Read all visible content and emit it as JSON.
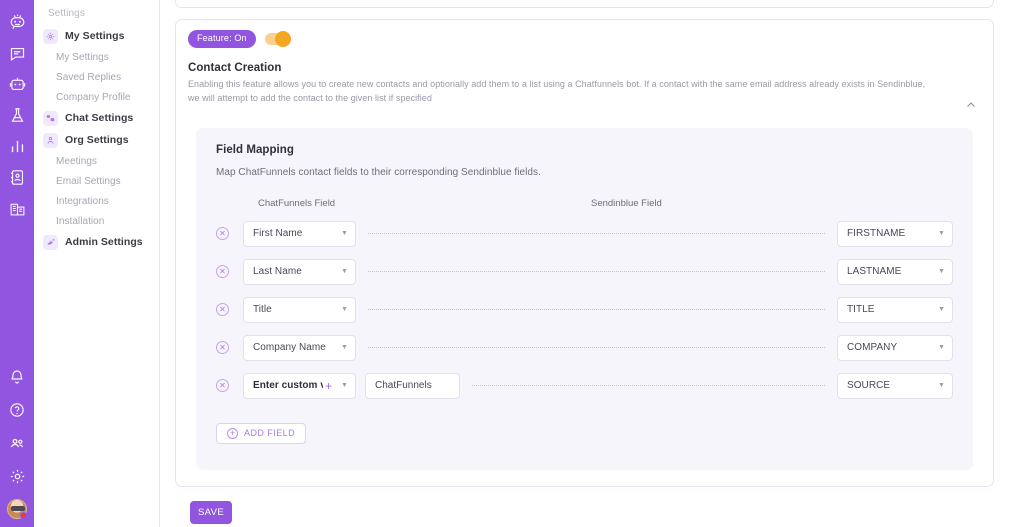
{
  "rail": {
    "top_icons": [
      {
        "name": "robot-logo-icon"
      },
      {
        "name": "chat-bubble-icon"
      },
      {
        "name": "bot-icon"
      },
      {
        "name": "flask-icon"
      },
      {
        "name": "bar-chart-icon"
      },
      {
        "name": "contact-card-icon"
      },
      {
        "name": "buildings-icon"
      }
    ],
    "bottom_icons": [
      {
        "name": "bell-icon"
      },
      {
        "name": "help-circle-icon"
      },
      {
        "name": "people-icon"
      },
      {
        "name": "gear-icon"
      }
    ],
    "avatar_name": "user-avatar",
    "brand_color": "#9155e0"
  },
  "sidebar": {
    "title": "Settings",
    "items": [
      {
        "label": "My Settings",
        "type": "group",
        "icon": "gear-icon"
      },
      {
        "label": "My Settings",
        "type": "sub"
      },
      {
        "label": "Saved Replies",
        "type": "sub"
      },
      {
        "label": "Company Profile",
        "type": "sub"
      },
      {
        "label": "Chat Settings",
        "type": "group",
        "icon": "chat-settings-icon"
      },
      {
        "label": "Org Settings",
        "type": "group",
        "icon": "org-icon"
      },
      {
        "label": "Meetings",
        "type": "sub"
      },
      {
        "label": "Email Settings",
        "type": "sub"
      },
      {
        "label": "Integrations",
        "type": "sub"
      },
      {
        "label": "Installation",
        "type": "sub"
      },
      {
        "label": "Admin Settings",
        "type": "group",
        "icon": "admin-icon"
      }
    ]
  },
  "feature": {
    "badge_label": "Feature: On",
    "toggle_on": true,
    "toggle_color": "#f5a623",
    "title": "Contact Creation",
    "description": "Enabling this feature allows you to create new contacts and optionally add them to a list using a Chatfunnels bot. If a contact with the same email address already exists in Sendinblue, we will attempt to add the contact to the given list if specified",
    "collapse_icon": "chevron-up-icon"
  },
  "field_mapping": {
    "title": "Field Mapping",
    "description": "Map ChatFunnels contact fields to their corresponding Sendinblue fields.",
    "columns": [
      "ChatFunnels Field",
      "Sendinblue Field"
    ],
    "rows": [
      {
        "source": "First Name",
        "custom": false,
        "custom_value": "",
        "target": "FIRSTNAME"
      },
      {
        "source": "Last Name",
        "custom": false,
        "custom_value": "",
        "target": "LASTNAME"
      },
      {
        "source": "Title",
        "custom": false,
        "custom_value": "",
        "target": "TITLE"
      },
      {
        "source": "Company Name",
        "custom": false,
        "custom_value": "",
        "target": "COMPANY"
      },
      {
        "source": "Enter custom value",
        "custom": true,
        "custom_value": "ChatFunnels",
        "target": "SOURCE"
      }
    ],
    "add_field_label": "ADD FIELD",
    "remove_icon": "remove-circle-icon"
  },
  "footer": {
    "save_label": "SAVE"
  }
}
